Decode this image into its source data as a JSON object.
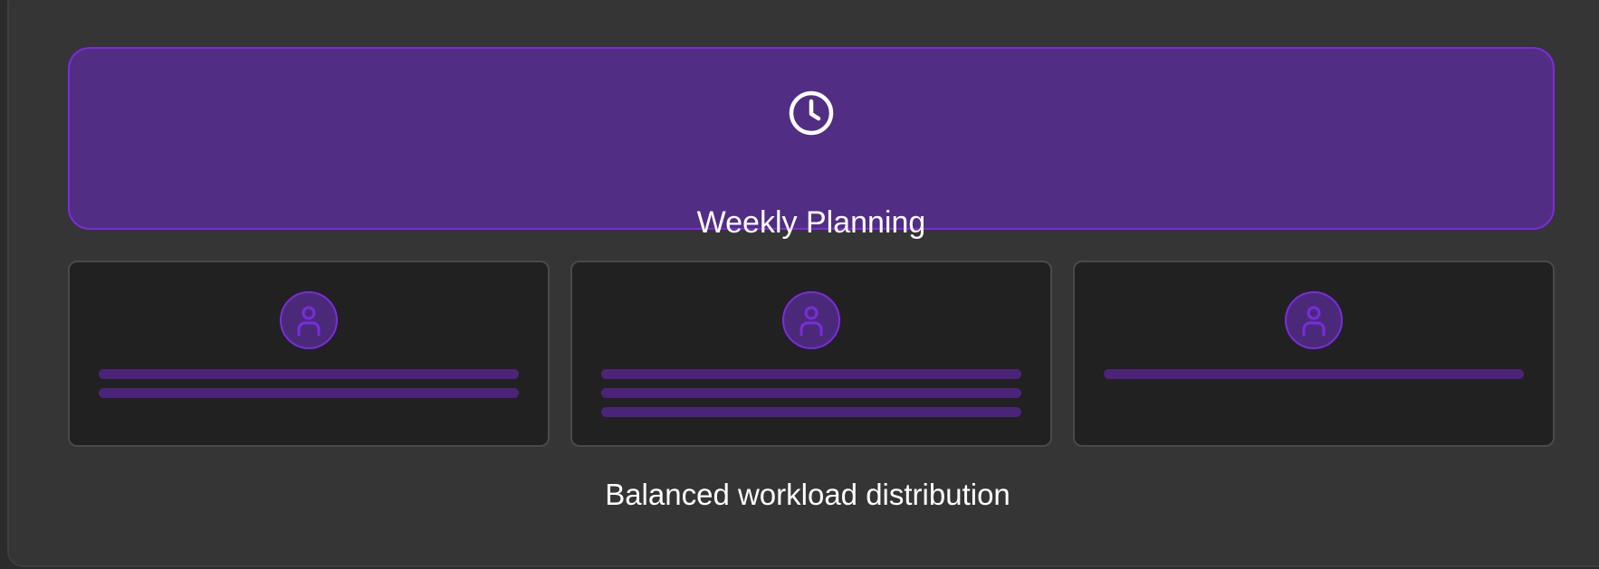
{
  "banner": {
    "icon": "clock-icon",
    "title": "Weekly Planning"
  },
  "cards": [
    {
      "icon": "user-icon",
      "task_count": 2
    },
    {
      "icon": "user-icon",
      "task_count": 3
    },
    {
      "icon": "user-icon",
      "task_count": 1
    }
  ],
  "caption": "Balanced workload distribution",
  "colors": {
    "accent": "#7b2be0",
    "banner_fill": "#512d84",
    "task_bar": "#4b2479",
    "card_fill": "#212121",
    "background": "#353535"
  }
}
